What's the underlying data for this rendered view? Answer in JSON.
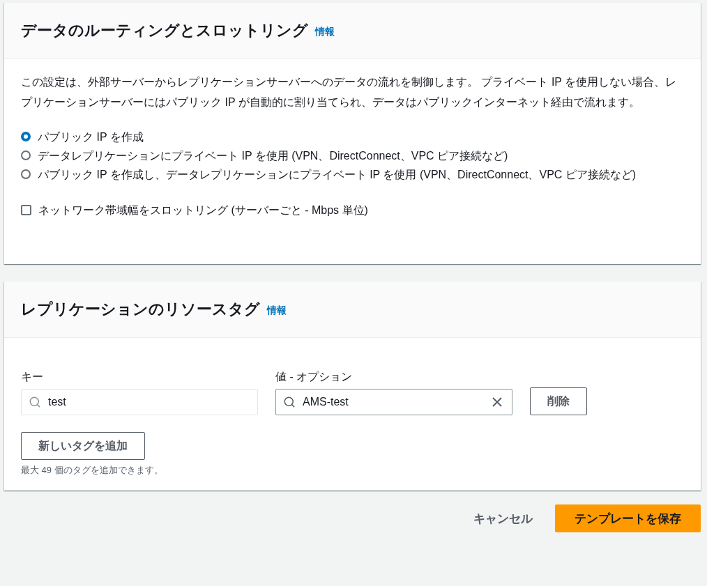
{
  "routing_panel": {
    "title": "データのルーティングとスロットリング",
    "info_link": "情報",
    "description": "この設定は、外部サーバーからレプリケーションサーバーへのデータの流れを制御します。 プライベート IP を使用しない場合、レプリケーションサーバーにはパブリック IP が自動的に割り当てられ、データはパブリックインターネット経由で流れます。",
    "options": [
      {
        "label": "パブリック IP を作成",
        "selected": true
      },
      {
        "label": "データレプリケーションにプライベート IP を使用 (VPN、DirectConnect、VPC ピア接続など)",
        "selected": false
      },
      {
        "label": "パブリック IP を作成し、データレプリケーションにプライベート IP を使用 (VPN、DirectConnect、VPC ピア接続など)",
        "selected": false
      }
    ],
    "throttle": {
      "label": "ネットワーク帯域幅をスロットリング (サーバーごと - Mbps 単位)",
      "checked": false
    }
  },
  "tags_panel": {
    "title": "レプリケーションのリソースタグ",
    "info_link": "情報",
    "key_label": "キー",
    "value_label": "値 - オプション",
    "tags": [
      {
        "key": "test",
        "value": "AMS-test",
        "remove_button": "削除"
      }
    ],
    "add_button": "新しいタグを追加",
    "hint": "最大 49 個のタグを追加できます。"
  },
  "footer": {
    "cancel": "キャンセル",
    "save": "テンプレートを保存"
  }
}
